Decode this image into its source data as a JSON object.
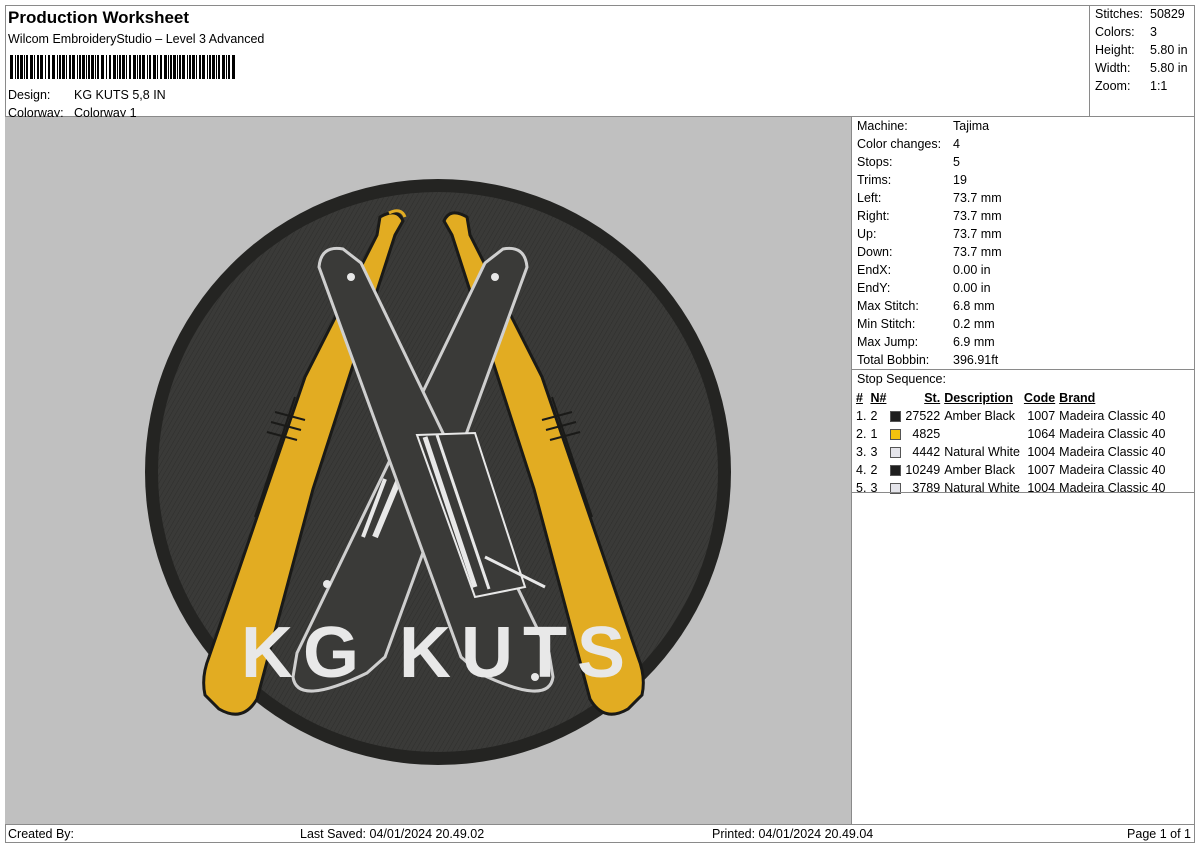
{
  "header": {
    "title": "Production Worksheet",
    "subtitle": "Wilcom EmbroideryStudio – Level 3 Advanced",
    "design_label": "Design:",
    "design_value": "KG KUTS 5,8 IN",
    "colorway_label": "Colorway:",
    "colorway_value": "Colorway 1"
  },
  "summary": [
    {
      "label": "Stitches:",
      "value": "50829"
    },
    {
      "label": "Colors:",
      "value": "3"
    },
    {
      "label": "Height:",
      "value": "5.80 in"
    },
    {
      "label": "Width:",
      "value": "5.80 in"
    },
    {
      "label": "Zoom:",
      "value": "1:1"
    }
  ],
  "machine_info": [
    {
      "label": "Machine:",
      "value": "Tajima"
    },
    {
      "label": "Color changes:",
      "value": "4"
    },
    {
      "label": "Stops:",
      "value": "5"
    },
    {
      "label": "Trims:",
      "value": "19"
    },
    {
      "label": "Left:",
      "value": "73.7 mm"
    },
    {
      "label": "Right:",
      "value": "73.7 mm"
    },
    {
      "label": "Up:",
      "value": "73.7 mm"
    },
    {
      "label": "Down:",
      "value": "73.7 mm"
    },
    {
      "label": "EndX:",
      "value": "0.00 in"
    },
    {
      "label": "EndY:",
      "value": "0.00 in"
    },
    {
      "label": "Max Stitch:",
      "value": "6.8 mm"
    },
    {
      "label": "Min Stitch:",
      "value": "0.2 mm"
    },
    {
      "label": "Max Jump:",
      "value": "6.9 mm"
    },
    {
      "label": "Total Bobbin:",
      "value": "396.91ft"
    }
  ],
  "stop_sequence": {
    "title": "Stop Sequence:",
    "headers": {
      "num": "#",
      "n": "N#",
      "st": "St.",
      "desc": "Description",
      "code": "Code",
      "brand": "Brand"
    },
    "rows": [
      {
        "num": "1.",
        "n": "2",
        "color": "#1e1e1e",
        "st": "27522",
        "desc": "Amber Black",
        "code": "1007",
        "brand": "Madeira Classic 40"
      },
      {
        "num": "2.",
        "n": "1",
        "color": "#f3c20f",
        "st": "4825",
        "desc": "",
        "code": "1064",
        "brand": "Madeira Classic 40"
      },
      {
        "num": "3.",
        "n": "3",
        "color": "#e4e4ea",
        "st": "4442",
        "desc": "Natural White",
        "code": "1004",
        "brand": "Madeira Classic 40"
      },
      {
        "num": "4.",
        "n": "2",
        "color": "#1e1e1e",
        "st": "10249",
        "desc": "Amber Black",
        "code": "1007",
        "brand": "Madeira Classic 40"
      },
      {
        "num": "5.",
        "n": "3",
        "color": "#e4e4ea",
        "st": "3789",
        "desc": "Natural White",
        "code": "1004",
        "brand": "Madeira Classic 40"
      }
    ]
  },
  "design_preview": {
    "patch_text": "KG KUTS",
    "colors": {
      "background": "#c0c0c0",
      "patch": "#3a3a38",
      "border": "#242422",
      "gold": "#e2ac22",
      "white": "#e8e8e8"
    }
  },
  "footer": {
    "created_by": "Created By:",
    "last_saved": "Last Saved: 04/01/2024 20.49.02",
    "printed": "Printed: 04/01/2024 20.49.04",
    "page": "Page 1 of 1"
  }
}
